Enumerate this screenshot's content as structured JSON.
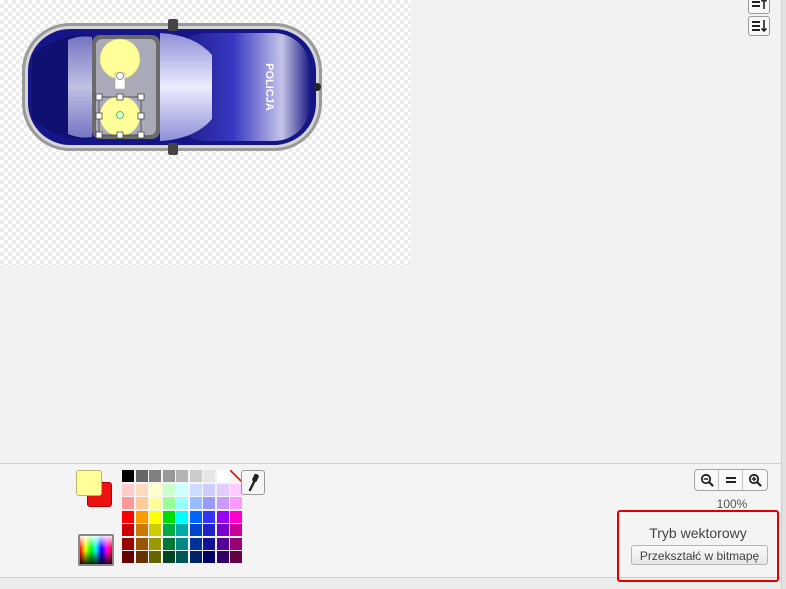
{
  "canvas": {
    "car_label": "POLICJA"
  },
  "layer_buttons": {
    "up_icon": "layer-up-icon",
    "down_icon": "layer-down-icon"
  },
  "colors": {
    "foreground": "#ffff99",
    "background": "#ee1111",
    "palette": [
      "#000000",
      "#666666",
      "#808080",
      "#999999",
      "#b3b3b3",
      "#cccccc",
      "#e6e6e6",
      "#ffffff",
      "none",
      "#ffcccc",
      "#ffdcc0",
      "#ffffcc",
      "#ccffcc",
      "#ccffff",
      "#ccddff",
      "#ccccff",
      "#e0ccff",
      "#ffccff",
      "#ff9999",
      "#ffcc99",
      "#ffff99",
      "#99ff99",
      "#99ffff",
      "#99bbff",
      "#9999ff",
      "#cc99ff",
      "#ff99ff",
      "#ff0000",
      "#ff9900",
      "#ffff00",
      "#00dd00",
      "#00ffff",
      "#0066ff",
      "#3333ff",
      "#9900ff",
      "#ff00cc",
      "#cc0000",
      "#cc7700",
      "#cccc00",
      "#00aa44",
      "#00aaaa",
      "#0044cc",
      "#2222cc",
      "#7700cc",
      "#cc0099",
      "#990000",
      "#995500",
      "#999900",
      "#007733",
      "#008888",
      "#003399",
      "#111199",
      "#550099",
      "#990077",
      "#660000",
      "#663300",
      "#666600",
      "#004422",
      "#005555",
      "#002266",
      "#000066",
      "#330066",
      "#660044"
    ]
  },
  "zoom": {
    "level": "100%"
  },
  "mode": {
    "title": "Tryb wektorowy",
    "convert_label": "Przekształć w bitmapę"
  }
}
